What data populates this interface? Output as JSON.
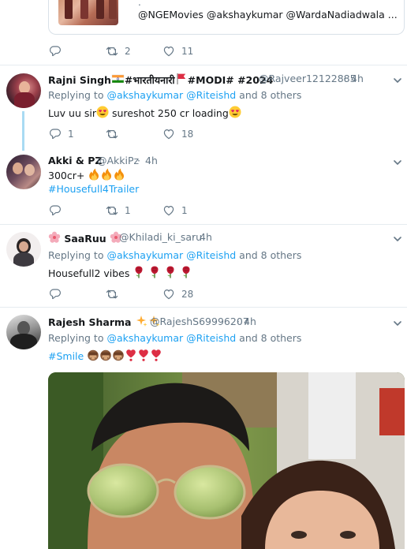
{
  "card": {
    "dot": ".",
    "text": "@NGEMovies @akshaykumar @WardaNadiadwala ..."
  },
  "first_actions": {
    "retweets": "2",
    "likes": "11"
  },
  "tweets": [
    {
      "name": "Rajni Singh",
      "name_suffix": "#भारतीयनारी",
      "name_tags": "#MODI# #2024",
      "handle": "@Rajveer12122885",
      "time": "4h",
      "replying_label": "Replying to",
      "replying_to": "@akshaykumar @Riteishd",
      "replying_more": "and 8 others",
      "text": "Luv uu sir",
      "text2": "sureshot 250 cr loading",
      "replies": "1",
      "retweets": "",
      "likes": "18"
    },
    {
      "name": "Akki & PZ",
      "handle": "@AkkiPz",
      "time": "4h",
      "text": "300cr+",
      "hashtag": "#Housefull4Trailer",
      "replies": "",
      "retweets": "1",
      "likes": "1"
    },
    {
      "name": "SaaRuu",
      "handle": "@Khiladi_ki_saru",
      "time": "4h",
      "replying_label": "Replying to",
      "replying_to": "@akshaykumar @Riteishd",
      "replying_more": "and 8 others",
      "text": "Housefull2 vibes",
      "replies": "",
      "retweets": "",
      "likes": "28"
    },
    {
      "name": "Rajesh Sharma",
      "handle": "@RajeshS69996207",
      "time": "4h",
      "replying_label": "Replying to",
      "replying_to": "@akshaykumar @Riteishd",
      "replying_more": "and 8 others",
      "hashtag": "#Smile"
    }
  ],
  "colors": {
    "accent": "#1da1f2",
    "muted": "#657786",
    "thread": "#a9dbf3",
    "divider": "#e6ecf0"
  },
  "icons": [
    "reply-icon",
    "retweet-icon",
    "like-icon",
    "chevron-down-icon",
    "india-flag-icon",
    "red-flag-icon",
    "heart-eyes-emoji",
    "fire-emoji",
    "rose-emoji",
    "sparkles-emoji",
    "see-no-evil-monkey-emoji",
    "heart-exclamation-emoji"
  ]
}
